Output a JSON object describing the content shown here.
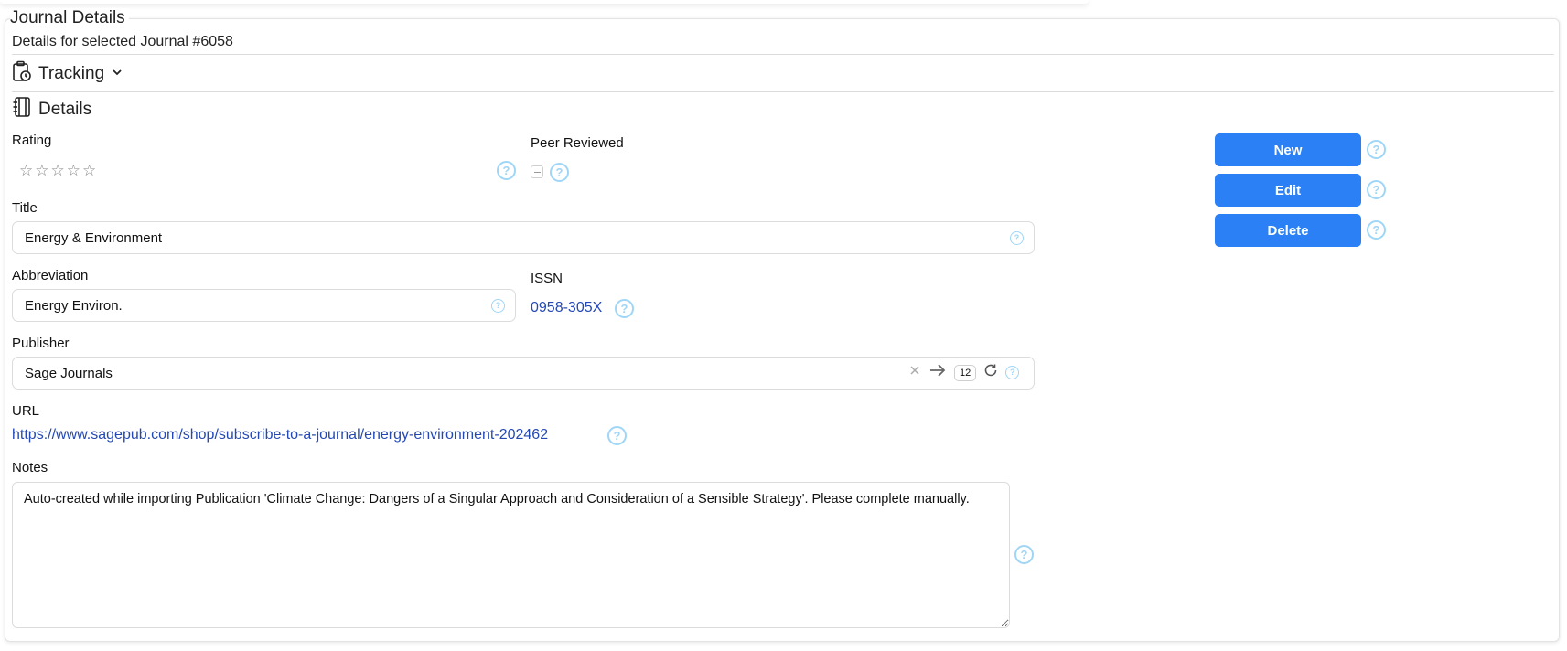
{
  "panel": {
    "legend": "Journal Details",
    "subtitle": "Details for selected Journal #6058"
  },
  "tracking": {
    "icon": "clipboard-clock-icon",
    "label": "Tracking",
    "chevron": "chevron-down-icon"
  },
  "details": {
    "icon": "notebook-icon",
    "label": "Details"
  },
  "rating": {
    "label": "Rating",
    "stars": 5,
    "value": 0
  },
  "peer_reviewed": {
    "label": "Peer Reviewed",
    "state": "indeterminate"
  },
  "title": {
    "label": "Title",
    "value": "Energy & Environment"
  },
  "abbreviation": {
    "label": "Abbreviation",
    "value": "Energy Environ."
  },
  "issn": {
    "label": "ISSN",
    "value": "0958-305X"
  },
  "publisher": {
    "label": "Publisher",
    "value": "Sage Journals",
    "count": "12"
  },
  "url": {
    "label": "URL",
    "value": "https://www.sagepub.com/shop/subscribe-to-a-journal/energy-environment-202462"
  },
  "notes": {
    "label": "Notes",
    "value": "Auto-created while importing Publication 'Climate Change: Dangers of a Singular Approach and Consideration of a Sensible Strategy'. Please complete manually."
  },
  "actions": {
    "new": "New",
    "edit": "Edit",
    "delete": "Delete"
  },
  "help_glyph": "?",
  "colors": {
    "primary_button": "#2b80f5",
    "link": "#2449b5",
    "help": "#9fd6f7"
  }
}
